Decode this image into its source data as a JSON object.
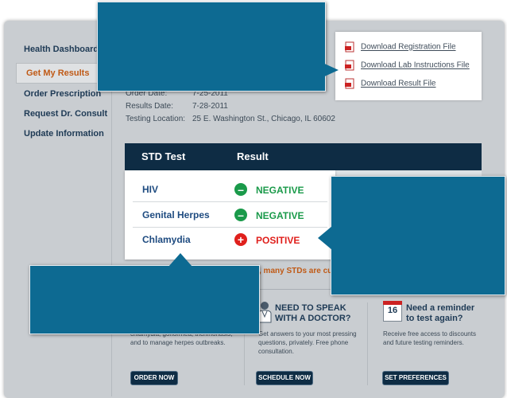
{
  "sidebar": {
    "items": [
      {
        "label": "Health Dashboard",
        "active": false
      },
      {
        "label": "Get My Results",
        "active": true
      },
      {
        "label": "Order Prescription",
        "active": false
      },
      {
        "label": "Request Dr. Consult",
        "active": false
      },
      {
        "label": "Update Information",
        "active": false
      }
    ]
  },
  "order_info": {
    "order_date_label": "Order Date:",
    "order_date_value": "7-25-2011",
    "results_date_label": "Results Date:",
    "results_date_value": "7-28-2011",
    "testing_location_label": "Testing Location:",
    "testing_location_value": "25 E. Washington St., Chicago, IL 60602"
  },
  "downloads": {
    "items": [
      {
        "label": "Download Registration File",
        "icon": "pdf-icon"
      },
      {
        "label": "Download Lab Instructions File",
        "icon": "pdf-icon"
      },
      {
        "label": "Download Result File",
        "icon": "pdf-icon"
      }
    ]
  },
  "results": {
    "col_test": "STD Test",
    "col_result": "Result",
    "rows": [
      {
        "test": "HIV",
        "result": "NEGATIVE",
        "icon": "minus-circle-icon",
        "color": "#1a9a4a"
      },
      {
        "test": "Genital Herpes",
        "result": "NEGATIVE",
        "icon": "minus-circle-icon",
        "color": "#1a9a4a"
      },
      {
        "test": "Chlamydia",
        "result": "POSITIVE",
        "icon": "plus-circle-icon",
        "color": "#e0201c"
      }
    ]
  },
  "warning_fragment": ", many STDs are cu",
  "panels": {
    "left": {
      "text": "chlamydia, gonorrhea, trichmonasis, and to manage herpes outbreaks.",
      "button": "ORDER NOW"
    },
    "middle": {
      "title": "NEED TO SPEAK WITH A DOCTOR?",
      "text": "Get answers to your most pressing questions, privately. Free phone consultation.",
      "button": "SCHEDULE NOW",
      "icon": "doctor-icon"
    },
    "right": {
      "title": "Need a reminder to test again?",
      "calendar_day": "16",
      "text": "Receive free access to discounts and future testing reminders.",
      "button": "SET PREFERENCES",
      "icon": "calendar-icon"
    }
  },
  "colors": {
    "accent": "#c05a16",
    "callout": "#0d6a92",
    "header": "#0e2c44",
    "negative": "#1a9a4a",
    "positive": "#e0201c"
  }
}
